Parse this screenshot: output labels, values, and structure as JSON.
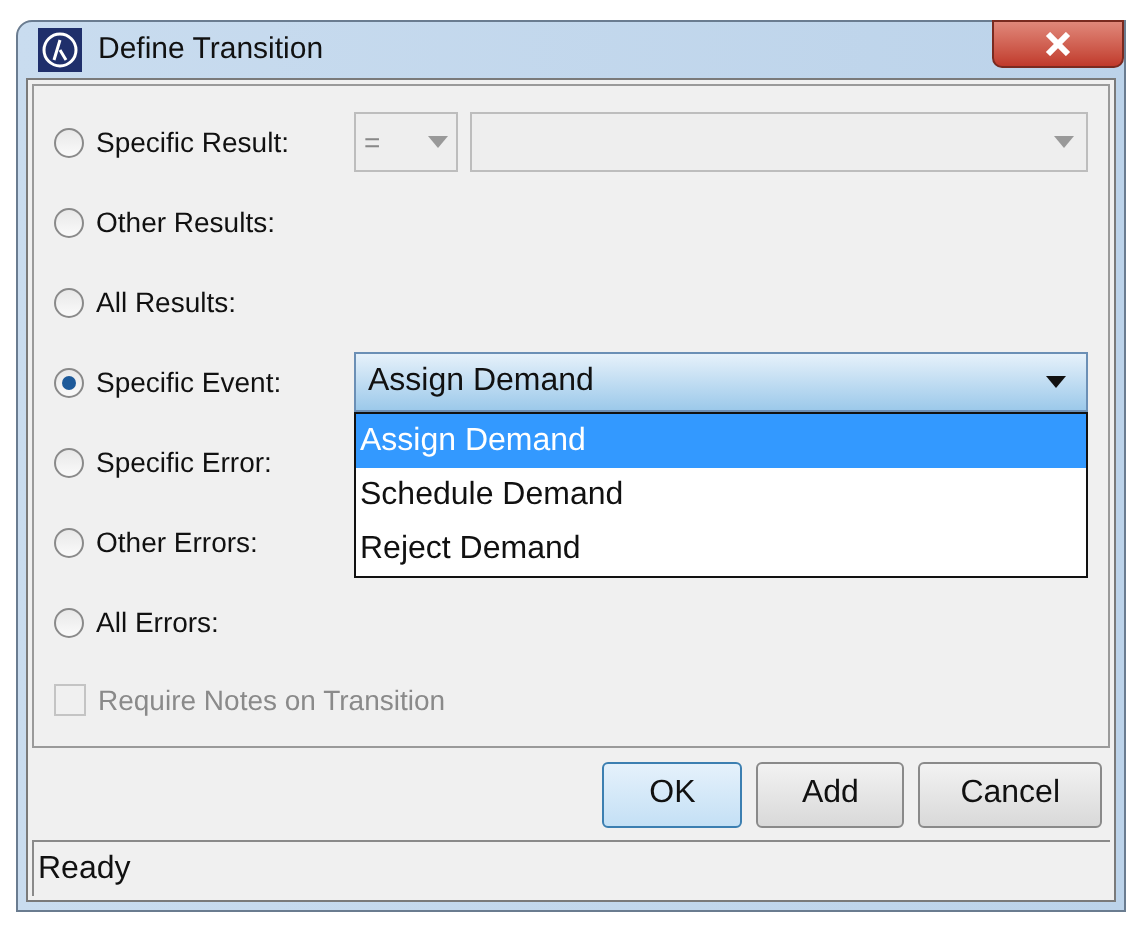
{
  "window": {
    "title": "Define Transition"
  },
  "options": [
    {
      "kind": "result",
      "label": "Specific Result:",
      "selected": false,
      "operator": "="
    },
    {
      "kind": "plain",
      "label": "Other Results:",
      "selected": false
    },
    {
      "kind": "plain",
      "label": "All Results:",
      "selected": false
    },
    {
      "kind": "event",
      "label": "Specific Event:",
      "selected": true,
      "value": "Assign Demand",
      "expanded": true,
      "choices": [
        {
          "label": "Assign Demand",
          "selected": true
        },
        {
          "label": "Schedule Demand",
          "selected": false
        },
        {
          "label": "Reject Demand",
          "selected": false
        }
      ]
    },
    {
      "kind": "plain",
      "label": "Specific Error:",
      "selected": false
    },
    {
      "kind": "plain",
      "label": "Other Errors:",
      "selected": false
    },
    {
      "kind": "plain",
      "label": "All Errors:",
      "selected": false
    }
  ],
  "require_notes": {
    "label": "Require Notes on Transition",
    "checked": false,
    "disabled": true
  },
  "buttons": [
    {
      "label": "OK",
      "default": true
    },
    {
      "label": "Add",
      "default": false
    },
    {
      "label": "Cancel",
      "default": false
    }
  ],
  "status_bar": "Ready"
}
